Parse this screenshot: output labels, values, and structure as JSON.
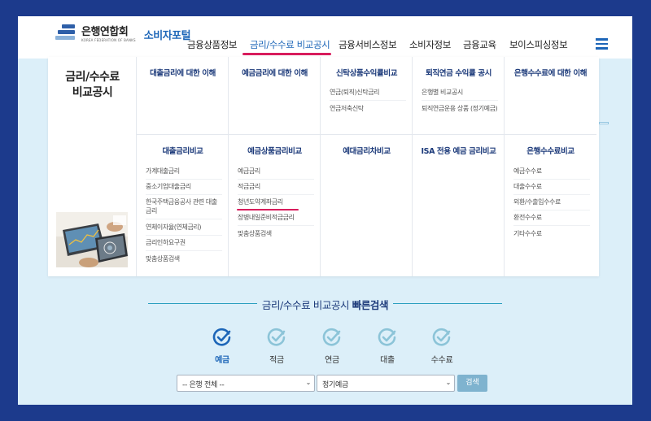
{
  "header": {
    "logo_name": "은행연합회",
    "logo_sub": "KOREA FEDERATION OF BANKS",
    "portal": "소비자포털",
    "nav": [
      "금융상품정보",
      "금리/수수료 비교공시",
      "금융서비스정보",
      "소비자정보",
      "금융교육",
      "보이스피싱정보"
    ],
    "active_nav": "금리/수수료 비교공시"
  },
  "mega_menu": {
    "title_line1": "금리/수수료",
    "title_line2": "비교공시",
    "row1": [
      {
        "title": "대출금리에 대한 이해",
        "items": []
      },
      {
        "title": "예금금리에 대한 이해",
        "items": []
      },
      {
        "title": "신탁상품수익률비교",
        "items": [
          "연금(퇴직)신탁금리",
          "연금저축신탁"
        ]
      },
      {
        "title": "퇴직연금 수익률 공시",
        "items": [
          "은행별 비교공시",
          "퇴직연금운용 상품 (정기예금)"
        ]
      },
      {
        "title": "은행수수료에 대한 이해",
        "items": []
      }
    ],
    "row2": [
      {
        "title": "대출금리비교",
        "items": [
          "가계대출금리",
          "중소기업대출금리",
          "한국주택금융공사 관련 대출금리",
          "연체이자율(연체금리)",
          "금리인하요구권",
          "맞춤상품검색"
        ]
      },
      {
        "title": "예금상품금리비교",
        "items": [
          "예금금리",
          "적금금리",
          "청년도약계좌금리",
          "장병내일준비적금금리",
          "맞춤상품검색"
        ]
      },
      {
        "title": "예대금리차비교",
        "items": []
      },
      {
        "title": "ISA 전용 예금 금리비교",
        "items": []
      },
      {
        "title": "은행수수료비교",
        "items": [
          "예금수수료",
          "대출수수료",
          "외환/수출입수수료",
          "환전수수료",
          "기타수수료"
        ]
      }
    ],
    "highlighted_item": "청년도약계좌금리"
  },
  "quick_search": {
    "title_normal": "금리/수수료 비교공시",
    "title_bold": "빠른검색",
    "tabs": [
      "예금",
      "적금",
      "연금",
      "대출",
      "수수료"
    ],
    "active_tab": "예금",
    "bank_select": "-- 은행 전체 --",
    "product_select": "정기예금",
    "search_button": "검색"
  },
  "colors": {
    "brand_blue": "#1d66b8",
    "accent_pink": "#d81c5c",
    "navy": "#1c3a8c",
    "icon_active": "#1d66b8",
    "icon_inactive": "#8cc4d8"
  }
}
